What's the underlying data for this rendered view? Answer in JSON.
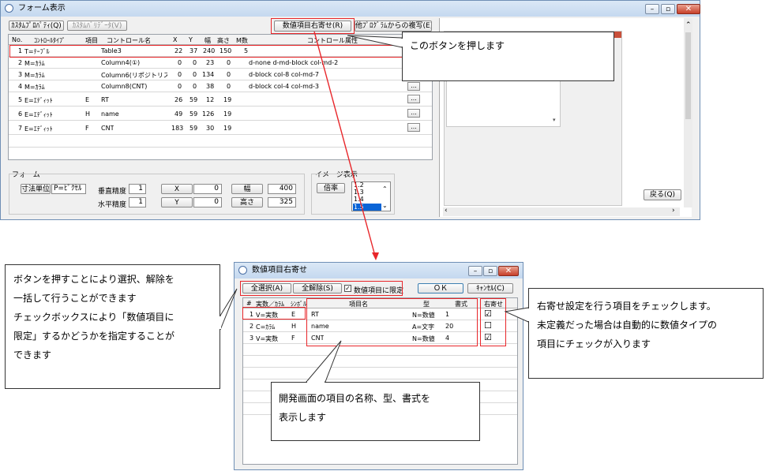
{
  "main_window": {
    "title": "フォーム表示",
    "toolbar": {
      "custom_property": "ｶｽﾀﾑﾌﾟﾛﾊﾟﾃｨ(Q)",
      "custom_validate": "ｶｽﾀﾑﾊﾞﾘﾃﾞｰﾀ(V)",
      "right_align": "数値項目右寄せ(R)",
      "copy_from_other": "他ﾌﾟﾛｸﾞﾗﾑからの複写(E)"
    },
    "table": {
      "headers": [
        "No.",
        "ｺﾝﾄﾛｰﾙﾀｲﾌﾟ",
        "項目",
        "コントロール名",
        "X",
        "Y",
        "幅",
        "高さ",
        "M数",
        "コントロール属性"
      ],
      "rows": [
        {
          "no": "1",
          "type": "T=ﾃｰﾌﾞﾙ",
          "item": "",
          "name": "Table3",
          "x": "22",
          "y": "37",
          "w": "240",
          "h": "150",
          "m": "5",
          "attr": ""
        },
        {
          "no": "2",
          "type": "M=ｶﾗﾑ",
          "item": "",
          "name": "Column4(①)",
          "x": "0",
          "y": "0",
          "w": "23",
          "h": "0",
          "m": "",
          "attr": "d-none d-md-block col-md-2"
        },
        {
          "no": "3",
          "type": "M=ｶﾗﾑ",
          "item": "",
          "name": "Column6(リポジトリス",
          "x": "0",
          "y": "0",
          "w": "134",
          "h": "0",
          "m": "",
          "attr": "d-block col-8 col-md-7"
        },
        {
          "no": "4",
          "type": "M=ｶﾗﾑ",
          "item": "",
          "name": "Column8(CNT)",
          "x": "0",
          "y": "0",
          "w": "38",
          "h": "0",
          "m": "",
          "attr": "d-block col-4 col-md-3"
        },
        {
          "no": "5",
          "type": "E=ｴﾃﾞｨｯﾄ",
          "item": "E",
          "name": "RT",
          "x": "26",
          "y": "59",
          "w": "12",
          "h": "19",
          "m": "",
          "attr": ""
        },
        {
          "no": "6",
          "type": "E=ｴﾃﾞｨｯﾄ",
          "item": "H",
          "name": "name",
          "x": "49",
          "y": "59",
          "w": "126",
          "h": "19",
          "m": "",
          "attr": ""
        },
        {
          "no": "7",
          "type": "E=ｴﾃﾞｨｯﾄ",
          "item": "F",
          "name": "CNT",
          "x": "183",
          "y": "59",
          "w": "30",
          "h": "19",
          "m": "",
          "attr": ""
        }
      ],
      "dots": "..."
    },
    "form": {
      "group": "フォーム",
      "unit_button": "寸法単位",
      "unit_value": "P=ﾋﾟｸｾﾙ",
      "v_precision_label": "垂直精度",
      "v_precision": "1",
      "h_precision_label": "水平精度",
      "h_precision": "1",
      "x_label": "X",
      "x_value": "0",
      "y_label": "Y",
      "y_value": "0",
      "w_label": "幅",
      "w_value": "400",
      "h_label": "高さ",
      "h_value": "325"
    },
    "image": {
      "group": "イメージ表示",
      "ratio_button": "倍率",
      "ratios": [
        "1.2",
        "1.3",
        "1.4",
        "1.5"
      ]
    },
    "back_button": "戻る(Q)"
  },
  "dialog": {
    "title": "数値項目右寄せ",
    "select_all": "全選択(A)",
    "clear_all": "全解除(S)",
    "limit_checkbox": "数値項目に限定",
    "ok": "ＯＫ",
    "cancel": "ｷｬﾝｾﾙ(C)",
    "headers": [
      "#",
      "実数／ｶﾗﾑ",
      "ｼﾝﾎﾞﾙ",
      "項目名",
      "型",
      "書式",
      "右寄せ"
    ],
    "rows": [
      {
        "no": "1",
        "kind": "V=実数",
        "sym": "E",
        "name": "RT",
        "type": "N=数値",
        "fmt": "1",
        "checked": "☑"
      },
      {
        "no": "2",
        "kind": "C=ｶﾗﾑ",
        "sym": "H",
        "name": "name",
        "type": "A=文字",
        "fmt": "20",
        "checked": "☐"
      },
      {
        "no": "3",
        "kind": "V=実数",
        "sym": "F",
        "name": "CNT",
        "type": "N=数値",
        "fmt": "4",
        "checked": "☑"
      }
    ]
  },
  "callouts": {
    "press_button": "このボタンを押します",
    "select_help_1": "ボタンを押すことにより選択、解除を",
    "select_help_2": "一括して行うことができます",
    "select_help_3": "チェックボックスにより「数値項目に",
    "select_help_4": "限定」するかどうかを指定することが",
    "select_help_5": "できます",
    "check_help_1": "右寄せ設定を行う項目をチェックします。",
    "check_help_2": "未定義だった場合は自動的に数値タイプの",
    "check_help_3": "項目にチェックが入ります",
    "display_help_1": "開発画面の項目の名称、型、書式を",
    "display_help_2": "表示します"
  },
  "colors": {
    "annotation": "#e8262a",
    "title_bar": "#c4d8ef"
  }
}
